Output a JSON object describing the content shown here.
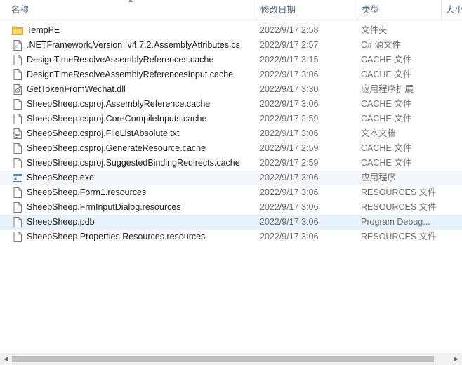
{
  "header": {
    "name": "名称",
    "date": "修改日期",
    "type": "类型",
    "size": "大小"
  },
  "files": [
    {
      "name": "TempPE",
      "date": "2022/9/17 2:58",
      "type": "文件夹",
      "icon": "folder-icon"
    },
    {
      "name": ".NETFramework,Version=v4.7.2.AssemblyAttributes.cs",
      "date": "2022/9/17 2:57",
      "type": "C# 源文件",
      "icon": "csharp-file-icon"
    },
    {
      "name": "DesignTimeResolveAssemblyReferences.cache",
      "date": "2022/9/17 3:15",
      "type": "CACHE 文件",
      "icon": "file-icon"
    },
    {
      "name": "DesignTimeResolveAssemblyReferencesInput.cache",
      "date": "2022/9/17 3:06",
      "type": "CACHE 文件",
      "icon": "file-icon"
    },
    {
      "name": "GetTokenFromWechat.dll",
      "date": "2022/9/17 3:30",
      "type": "应用程序扩展",
      "icon": "dll-file-icon"
    },
    {
      "name": "SheepSheep.csproj.AssemblyReference.cache",
      "date": "2022/9/17 3:06",
      "type": "CACHE 文件",
      "icon": "file-icon"
    },
    {
      "name": "SheepSheep.csproj.CoreCompileInputs.cache",
      "date": "2022/9/17 2:59",
      "type": "CACHE 文件",
      "icon": "file-icon"
    },
    {
      "name": "SheepSheep.csproj.FileListAbsolute.txt",
      "date": "2022/9/17 3:06",
      "type": "文本文档",
      "icon": "text-file-icon"
    },
    {
      "name": "SheepSheep.csproj.GenerateResource.cache",
      "date": "2022/9/17 2:59",
      "type": "CACHE 文件",
      "icon": "file-icon"
    },
    {
      "name": "SheepSheep.csproj.SuggestedBindingRedirects.cache",
      "date": "2022/9/17 2:59",
      "type": "CACHE 文件",
      "icon": "file-icon"
    },
    {
      "name": "SheepSheep.exe",
      "date": "2022/9/17 3:06",
      "type": "应用程序",
      "icon": "exe-file-icon"
    },
    {
      "name": "SheepSheep.Form1.resources",
      "date": "2022/9/17 3:06",
      "type": "RESOURCES 文件",
      "icon": "file-icon"
    },
    {
      "name": "SheepSheep.FrmInputDialog.resources",
      "date": "2022/9/17 3:06",
      "type": "RESOURCES 文件",
      "icon": "file-icon"
    },
    {
      "name": "SheepSheep.pdb",
      "date": "2022/9/17 3:06",
      "type": "Program Debug...",
      "icon": "file-icon"
    },
    {
      "name": "SheepSheep.Properties.Resources.resources",
      "date": "2022/9/17 3:06",
      "type": "RESOURCES 文件",
      "icon": "file-icon"
    }
  ],
  "colors": {
    "folder": "#f3c746",
    "header_text": "#4c607a",
    "row_highlight": "#f3f6fa",
    "row_selected": "#e5f1fb"
  }
}
